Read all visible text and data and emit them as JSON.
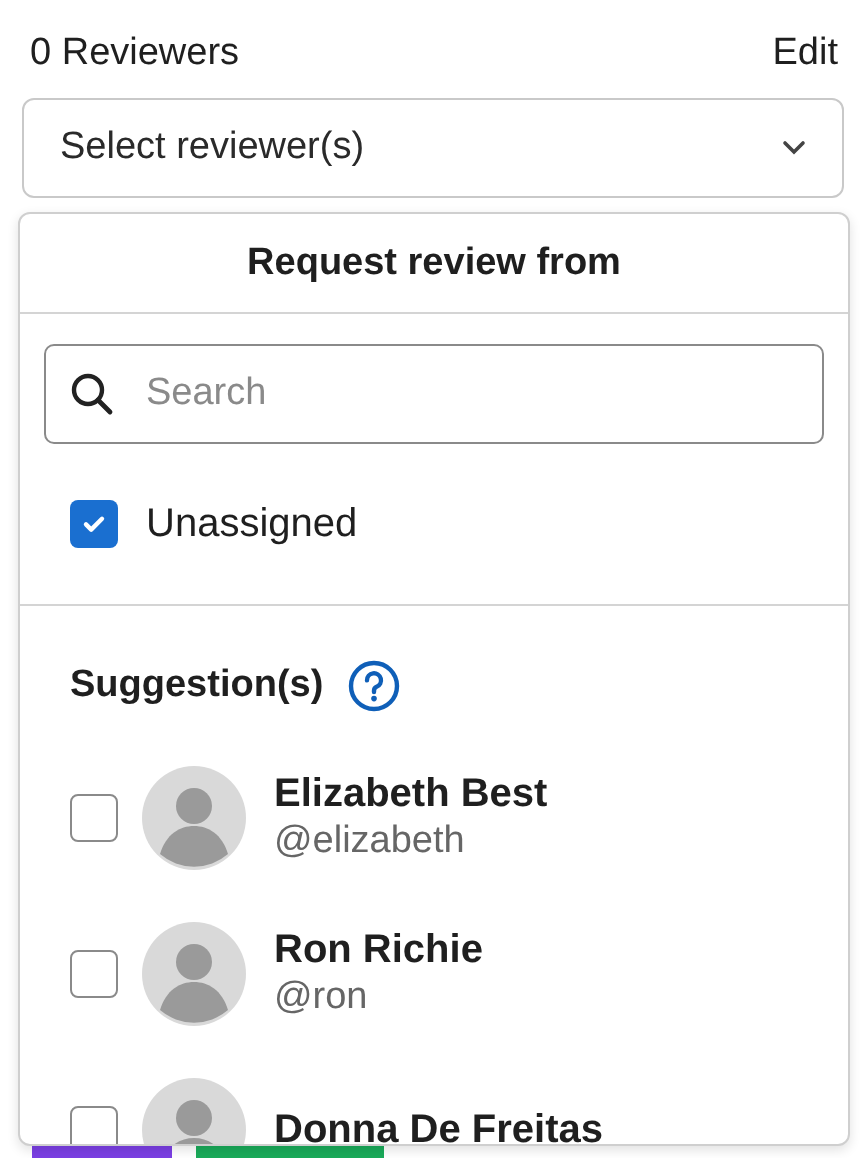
{
  "header": {
    "title": "0 Reviewers",
    "edit_link": "Edit"
  },
  "select": {
    "placeholder": "Select reviewer(s)"
  },
  "labels": [
    {
      "color": "#7b3fe4"
    },
    {
      "color": "#1aab5a"
    }
  ],
  "dropdown": {
    "title": "Request review from",
    "search": {
      "placeholder": "Search"
    },
    "unassigned": {
      "label": "Unassigned",
      "checked": true
    },
    "suggestions_heading": "Suggestion(s)",
    "users": [
      {
        "name": "Elizabeth Best",
        "handle": "@elizabeth",
        "checked": false
      },
      {
        "name": "Ron Richie",
        "handle": "@ron",
        "checked": false
      },
      {
        "name": "Donna De Freitas",
        "checked": false
      }
    ]
  }
}
